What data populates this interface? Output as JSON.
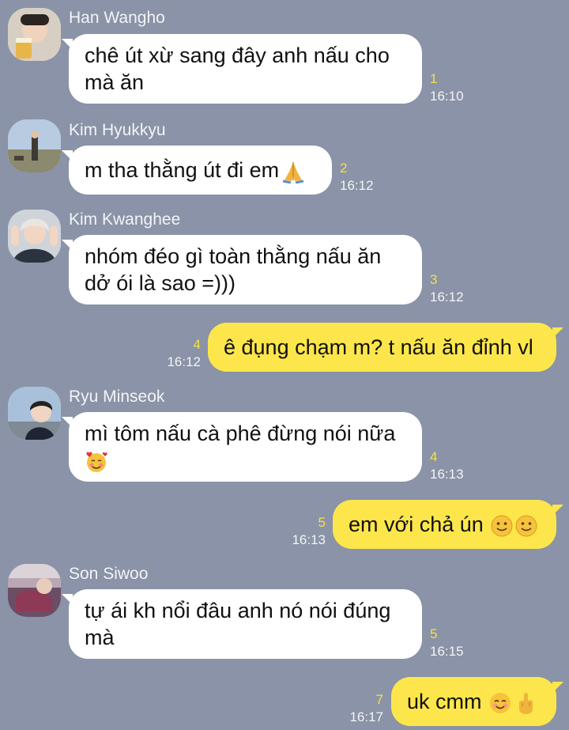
{
  "messages": [
    {
      "sender": "Han Wangho",
      "text": "chê út xừ sang đây anh nấu cho mà ăn",
      "unread": "1",
      "time": "16:10"
    },
    {
      "sender": "Kim Hyukkyu",
      "text": "m tha thằng út đi em",
      "unread": "2",
      "time": "16:12"
    },
    {
      "sender": "Kim Kwanghee",
      "text": "nhóm đéo gì toàn thằng nấu ăn dở ói là sao =)))",
      "unread": "3",
      "time": "16:12"
    },
    {
      "sender": "",
      "text": "ê đụng chạm m? t nấu ăn đỉnh vl",
      "unread": "4",
      "time": "16:12"
    },
    {
      "sender": "Ryu Minseok",
      "text": "mì tôm nấu cà phê đừng nói nữa",
      "unread": "4",
      "time": "16:13"
    },
    {
      "sender": "",
      "text": "em với chả ún",
      "unread": "5",
      "time": "16:13"
    },
    {
      "sender": "Son Siwoo",
      "text": "tự ái kh nổi đâu anh nó nói đúng mà",
      "unread": "5",
      "time": "16:15"
    },
    {
      "sender": "",
      "text": "uk cmm",
      "unread": "7",
      "time": "16:17"
    }
  ],
  "icons": {
    "m2": "folded-hands-emoji",
    "m5": "smiling-face-with-hearts-emoji",
    "m6": "slightly-smiling-face-emoji",
    "m8a": "smiling-face-emoji",
    "m8b": "middle-finger-emoji"
  },
  "colors": {
    "background": "#8a93a7",
    "incoming": "#ffffff",
    "outgoing": "#fde64b",
    "unread": "#f5e14a"
  }
}
